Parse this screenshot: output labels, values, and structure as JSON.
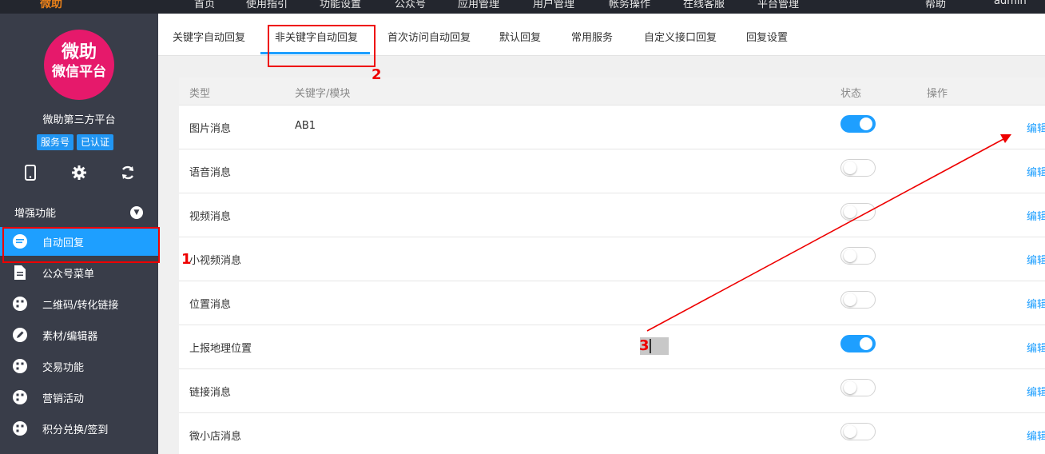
{
  "topnav": {
    "brand": "微助",
    "items": [
      "首页",
      "使用指引",
      "功能设置",
      "公众号",
      "应用管理",
      "用户管理",
      "帐务操作",
      "在线客服",
      "平台管理",
      "帮助",
      "admin"
    ]
  },
  "sidebar": {
    "logo_line1": "微助",
    "logo_line2": "微信平台",
    "account_name": "微助第三方平台",
    "badges": [
      "服务号",
      "已认证"
    ],
    "tool_icons": [
      "mobile-icon",
      "gear-icon",
      "refresh-icon"
    ],
    "section_title": "增强功能",
    "menu": [
      {
        "label": "自动回复",
        "icon": "chat-icon",
        "active": true
      },
      {
        "label": "公众号菜单",
        "icon": "document-icon",
        "active": false
      },
      {
        "label": "二维码/转化链接",
        "icon": "qr-icon",
        "active": false
      },
      {
        "label": "素材/编辑器",
        "icon": "pencil-icon",
        "active": false
      },
      {
        "label": "交易功能",
        "icon": "trade-icon",
        "active": false
      },
      {
        "label": "营销活动",
        "icon": "marketing-icon",
        "active": false
      },
      {
        "label": "积分兑换/签到",
        "icon": "points-icon",
        "active": false
      }
    ]
  },
  "tabs": [
    {
      "label": "关键字自动回复",
      "active": false
    },
    {
      "label": "非关键字自动回复",
      "active": true
    },
    {
      "label": "首次访问自动回复",
      "active": false
    },
    {
      "label": "默认回复",
      "active": false
    },
    {
      "label": "常用服务",
      "active": false
    },
    {
      "label": "自定义接口回复",
      "active": false
    },
    {
      "label": "回复设置",
      "active": false
    }
  ],
  "table": {
    "headers": {
      "type": "类型",
      "keyword": "关键字/模块",
      "status": "状态",
      "action": "操作"
    },
    "rows": [
      {
        "type": "图片消息",
        "keyword": "AB1",
        "enabled": true,
        "action": "编辑"
      },
      {
        "type": "语音消息",
        "keyword": "",
        "enabled": false,
        "action": "编辑"
      },
      {
        "type": "视频消息",
        "keyword": "",
        "enabled": false,
        "action": "编辑"
      },
      {
        "type": "小视频消息",
        "keyword": "",
        "enabled": false,
        "action": "编辑"
      },
      {
        "type": "位置消息",
        "keyword": "",
        "enabled": false,
        "action": "编辑"
      },
      {
        "type": "上报地理位置",
        "keyword": "",
        "enabled": true,
        "action": "编辑"
      },
      {
        "type": "链接消息",
        "keyword": "",
        "enabled": false,
        "action": "编辑"
      },
      {
        "type": "微小店消息",
        "keyword": "",
        "enabled": false,
        "action": "编辑"
      }
    ]
  },
  "annotations": {
    "n1": "1",
    "n2": "2",
    "n3": "3",
    "color": "#e00000"
  },
  "colors": {
    "accent": "#1e9fff",
    "sidebar_bg": "#393d49",
    "topbar_bg": "#23262e",
    "logo_bg": "#e6196b"
  }
}
